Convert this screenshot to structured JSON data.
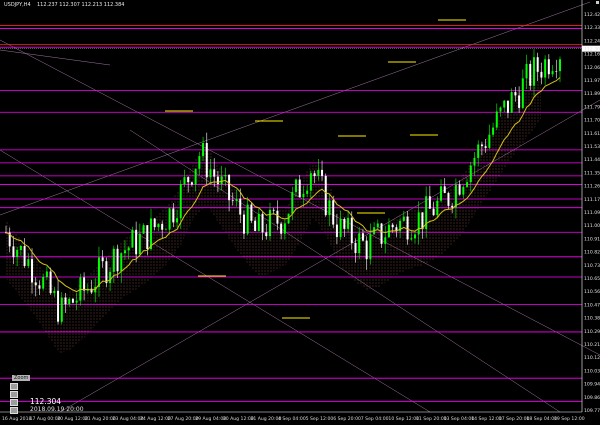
{
  "header": {
    "symbol_line": "USDJPY,H4",
    "ohlc_line": "112.237 112.307 112.213 112.384"
  },
  "price_axis": {
    "labels": [
      "112.421",
      "112.336",
      "112.248",
      "112.160",
      "112.060",
      "111.975",
      "111.890",
      "111.792",
      "111.703",
      "111.618",
      "111.530",
      "111.440",
      "111.352",
      "111.265",
      "111.175",
      "111.090",
      "111.000",
      "110.912",
      "110.825",
      "110.738",
      "110.650",
      "110.560",
      "110.470",
      "110.385",
      "110.297",
      "110.210",
      "110.120",
      "110.032",
      "109.945",
      "109.860",
      "109.770"
    ],
    "current_price_tag": "112.304"
  },
  "time_axis": {
    "labels": [
      "16 Aug 2018",
      "17 Aug 00:00",
      "20 Aug 12:00",
      "21 Aug 20:00",
      "23 Aug 04:00",
      "24 Aug 12:00",
      "27 Aug 20:00",
      "29 Aug 04:00",
      "30 Aug 12:00",
      "31 Aug 20:00",
      "4 Sep 04:00",
      "5 Sep 12:00",
      "6 Sep 20:00",
      "7 Sep 04:00",
      "10 Sep 12:00",
      "11 Sep 20:00",
      "13 Sep 04:00",
      "14 Sep 12:00",
      "17 Sep 20:00",
      "18 Sep 04:00",
      "19 Sep 12:00"
    ]
  },
  "crosshair_panel": {
    "label": "Zoom",
    "price_value": "112.304",
    "datetime_value": "2018.09.19 20:00"
  },
  "colors": {
    "background": "#000000",
    "bull_candle": "#00ff00",
    "bear_candle": "#ffffff",
    "moving_average": "#d4c21a",
    "support_resistance": "#ff00ff",
    "red_line": "#ff2020",
    "markers": "#ffee00",
    "trendlines": "#d8a0d8",
    "cloud": "#c87060"
  },
  "chart_data": {
    "type": "candlestick",
    "symbol": "USDJPY",
    "timeframe": "H4",
    "ylim": [
      109.72,
      112.46
    ],
    "x": [
      "16 Aug 2018",
      "17 Aug 00:00",
      "20 Aug 12:00",
      "21 Aug 20:00",
      "23 Aug 04:00",
      "24 Aug 12:00",
      "27 Aug 20:00",
      "29 Aug 04:00",
      "30 Aug 12:00",
      "31 Aug 20:00",
      "4 Sep 04:00",
      "5 Sep 12:00",
      "6 Sep 20:00",
      "7 Sep 04:00",
      "10 Sep 12:00",
      "11 Sep 20:00",
      "13 Sep 04:00",
      "14 Sep 12:00",
      "17 Sep 20:00",
      "18 Sep 04:00",
      "19 Sep 12:00"
    ],
    "close": [
      110.95,
      110.7,
      110.4,
      110.58,
      110.8,
      110.92,
      111.1,
      111.5,
      111.2,
      110.95,
      111.05,
      111.4,
      110.98,
      110.85,
      111.0,
      111.05,
      111.2,
      111.5,
      111.8,
      112.05,
      112.21
    ],
    "horizontal_levels": [
      112.36,
      112.23,
      111.93,
      111.78,
      111.52,
      111.43,
      111.34,
      111.28,
      111.18,
      111.12,
      110.95,
      110.78,
      110.64,
      110.45,
      110.26,
      109.94,
      109.78
    ],
    "red_levels": [
      112.38,
      112.25
    ]
  }
}
